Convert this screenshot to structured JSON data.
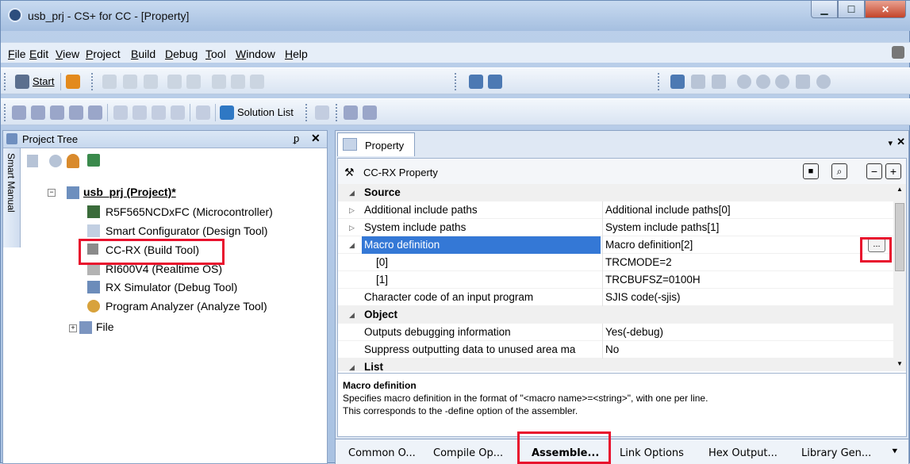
{
  "window": {
    "title": "usb_prj - CS+ for CC - [Property]"
  },
  "menu": [
    {
      "label": "File",
      "key": "F"
    },
    {
      "label": "Edit",
      "key": "E"
    },
    {
      "label": "View",
      "key": "V"
    },
    {
      "label": "Project",
      "key": "P"
    },
    {
      "label": "Build",
      "key": "B"
    },
    {
      "label": "Debug",
      "key": "D"
    },
    {
      "label": "Tool",
      "key": "T"
    },
    {
      "label": "Window",
      "key": "W"
    },
    {
      "label": "Help",
      "key": "H"
    }
  ],
  "toolbar": {
    "start_label": "Start",
    "solution_list_label": "Solution List"
  },
  "project_tree": {
    "title": "Project Tree",
    "side_tab": "Smart Manual",
    "root": "usb_prj (Project)*",
    "items": [
      "R5F565NCDxFC (Microcontroller)",
      "Smart Configurator (Design Tool)",
      "CC-RX (Build Tool)",
      "RI600V4 (Realtime OS)",
      "RX Simulator (Debug Tool)",
      "Program Analyzer (Analyze Tool)",
      "File"
    ]
  },
  "property": {
    "tab_label": "Property",
    "header": "CC-RX Property",
    "rows": [
      {
        "type": "cat",
        "name": "Source",
        "value": ""
      },
      {
        "type": "item",
        "name": "Additional include paths",
        "value": "Additional include paths[0]",
        "arrow": "▷"
      },
      {
        "type": "item",
        "name": "System include paths",
        "value": "System include paths[1]",
        "arrow": "▷"
      },
      {
        "type": "sel",
        "name": "Macro definition",
        "value": "Macro definition[2]",
        "arrow": "◢"
      },
      {
        "type": "sub",
        "name": "[0]",
        "value": "TRCMODE=2"
      },
      {
        "type": "sub",
        "name": "[1]",
        "value": "TRCBUFSZ=0100H"
      },
      {
        "type": "item",
        "name": "Character code of an input program",
        "value": "SJIS code(-sjis)"
      },
      {
        "type": "cat",
        "name": "Object",
        "value": ""
      },
      {
        "type": "item",
        "name": "Outputs debugging information",
        "value": "Yes(-debug)"
      },
      {
        "type": "item",
        "name": "Suppress outputting data to unused area ma",
        "value": "No"
      },
      {
        "type": "cat",
        "name": "List",
        "value": ""
      }
    ],
    "ellipsis_label": "...",
    "description": {
      "title": "Macro definition",
      "line1": "Specifies macro definition in the format of \"<macro name>=<string>\", with one per line.",
      "line2": "This corresponds to the -define option of the assembler."
    },
    "tabs": [
      "Common O...",
      "Compile Op...",
      "Assemble...",
      "Link Options",
      "Hex Output...",
      "Library Gen..."
    ]
  },
  "colors": {
    "highlight": "#e8112d",
    "selection": "#3478d6"
  }
}
